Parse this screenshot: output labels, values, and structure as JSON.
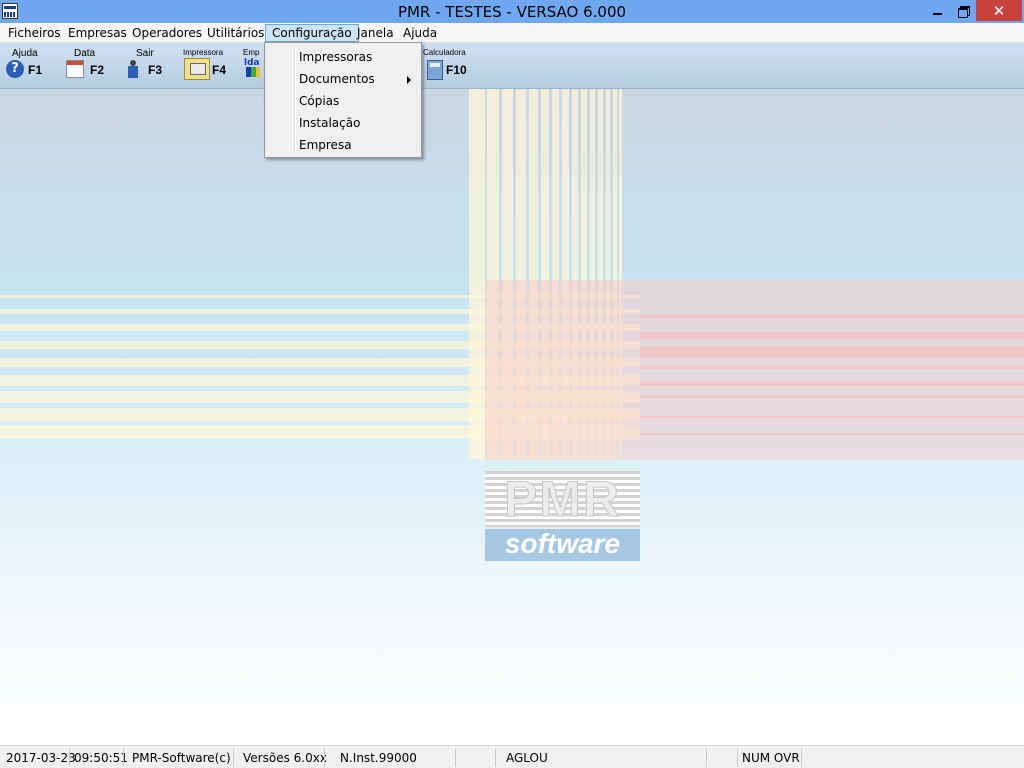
{
  "window": {
    "title": "PMR - TESTES - VERSAO 6.000",
    "close_symbol": "✕"
  },
  "menubar": {
    "items": [
      "Ficheiros",
      "Empresas",
      "Operadores",
      "Utilitários",
      "Configuração",
      "Janela",
      "Ajuda"
    ],
    "active": "Configuração"
  },
  "toolbar": {
    "buttons": [
      {
        "label": "Ajuda",
        "key": "F1",
        "icon": "help-icon"
      },
      {
        "label": "Data",
        "key": "F2",
        "icon": "calendar-icon"
      },
      {
        "label": "Sair",
        "key": "F3",
        "icon": "exit-icon"
      },
      {
        "label": "Impressora",
        "key": "F4",
        "icon": "printer-icon"
      },
      {
        "label": "Emp",
        "key": "",
        "icon": "company-icon"
      },
      {
        "label": "Calculadora",
        "key": "F10",
        "icon": "calculator-icon"
      }
    ]
  },
  "dropdown": {
    "items": [
      {
        "label": "Impressoras",
        "submenu": false
      },
      {
        "label": "Documentos",
        "submenu": true
      },
      {
        "label": "Cópias",
        "submenu": false
      },
      {
        "label": "Instalação",
        "submenu": false
      },
      {
        "label": "Empresa",
        "submenu": false
      }
    ]
  },
  "logo": {
    "brand": "PMR",
    "tagline": "software"
  },
  "statusbar": {
    "date": "2017-03-23",
    "time": "09:50:51",
    "company": "PMR-Software(c)",
    "versions": "Versões 6.0xx",
    "install": "N.Inst.99000",
    "user": "AGLOU",
    "keys": "NUM OVR"
  },
  "colors": {
    "titlebar": "#6fa8f0",
    "close": "#c7423b",
    "active_menu": "#cce4f7"
  }
}
